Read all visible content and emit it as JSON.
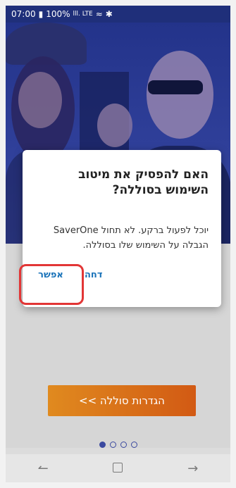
{
  "status_bar": {
    "time": "07:00",
    "battery": "100%",
    "indicators": "lll. LTE",
    "icons": [
      "battery-icon",
      "signal-icon",
      "wifi-icon",
      "bluetooth-icon"
    ]
  },
  "dialog": {
    "title": "האם להפסיק את מיטוב השימוש בסוללה?",
    "body": "יוכל לפעול ברקע. לא תחול SaverOne הגבלה על השימוש שלו בסוללה.",
    "deny_label": "דחה",
    "allow_label": "אפשר",
    "accent_color": "#1a73b9"
  },
  "settings_button": {
    "label": "הגדרות סוללה >>"
  },
  "pager": {
    "total": 4,
    "active_index": 0
  },
  "nav_bar": {
    "icons": [
      "back-gesture-icon",
      "recent-apps-icon",
      "forward-arrow-icon"
    ]
  },
  "colors": {
    "brand_blue": "#23338a",
    "button_orange": "#e08a1f",
    "highlight_red": "#e23636"
  }
}
